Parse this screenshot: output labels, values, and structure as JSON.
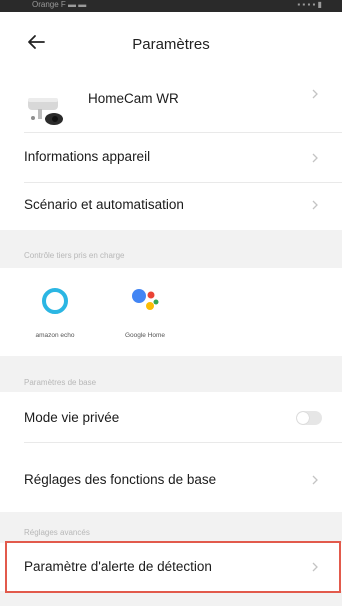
{
  "status_bar": {
    "left": "Orange F  ▬ ▬",
    "right": "▪ ▪ ▪ ▪ ▮"
  },
  "header": {
    "title": "Paramètres"
  },
  "device": {
    "name": "HomeCam WR"
  },
  "menu": {
    "device_info": "Informations appareil",
    "scenario": "Scénario et automatisation"
  },
  "third_party": {
    "section_label": "Contrôle tiers pris en charge",
    "alexa_caption": "amazon echo",
    "google_caption": "Google Home"
  },
  "basic": {
    "section_label": "Paramètres de base",
    "privacy_mode": "Mode vie privée",
    "privacy_enabled": false,
    "basic_settings": "Réglages des fonctions de base"
  },
  "advanced": {
    "section_label": "Réglages avancés",
    "detection_alert": "Paramètre d'alerte de détection"
  },
  "colors": {
    "highlight": "#e25a4c",
    "alexa": "#2bb6e3",
    "google_blue": "#4285f4",
    "google_red": "#ea4335",
    "google_yellow": "#fbbc05",
    "google_green": "#34a853"
  }
}
